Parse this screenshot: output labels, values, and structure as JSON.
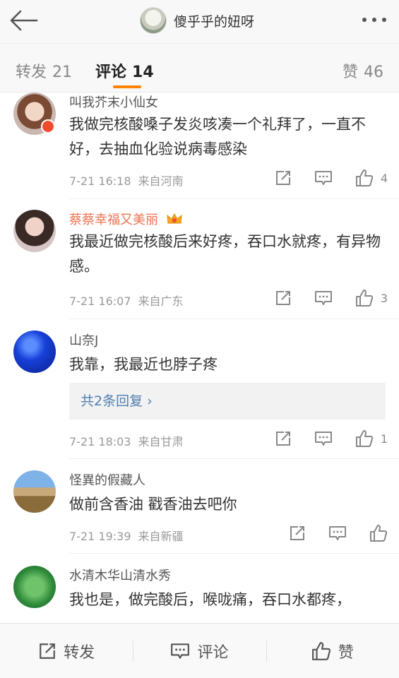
{
  "header": {
    "title": "傻乎乎的妞呀"
  },
  "tabs": {
    "repost": {
      "label": "转发",
      "count": "21"
    },
    "comment": {
      "label": "评论",
      "count": "14"
    },
    "like": {
      "label": "赞",
      "count": "46"
    }
  },
  "comments": [
    {
      "name": "叫我芥末小仙女",
      "text": "我做完核酸嗓子发炎咳凑一个礼拜了，一直不好，去抽血化验说病毒感染",
      "time": "7-21 16:18",
      "source": "来自河南",
      "likes": "4"
    },
    {
      "name": "蔡蔡幸福又美丽",
      "text": "我最近做完核酸后来好疼，吞口水就疼，有异物感。",
      "time": "7-21 16:07",
      "source": "来自广东",
      "likes": "3"
    },
    {
      "name": "山奈J",
      "text": "我靠，我最近也脖子疼",
      "reply": "共2条回复 ›",
      "time": "7-21 18:03",
      "source": "来自甘肃",
      "likes": "1"
    },
    {
      "name": "怪異的假藏人",
      "text": "做前含香油 戳香油去吧你",
      "time": "7-21 19:39",
      "source": "来自新疆",
      "likes": ""
    },
    {
      "name": "水清木华山清水秀",
      "text": "我也是，做完酸后，喉咙痛，吞口水都疼，"
    }
  ],
  "bottom": {
    "repost": "转发",
    "comment": "评论",
    "like": "赞"
  },
  "colors": {
    "accent": "#ff8200",
    "vip_name": "#eb7350",
    "link": "#507daf"
  },
  "icons": [
    "back-arrow-icon",
    "more-dots-icon",
    "share-icon",
    "comment-icon",
    "thumbs-up-icon",
    "crown-icon"
  ]
}
